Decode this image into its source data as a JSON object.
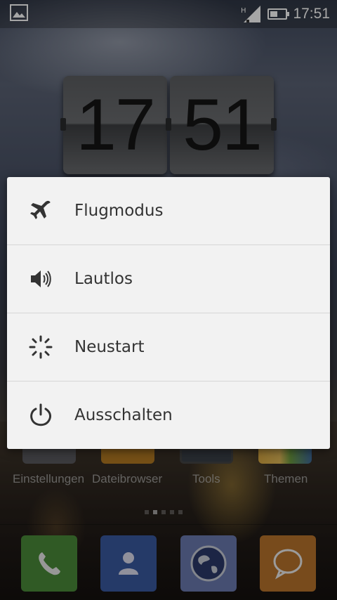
{
  "statusbar": {
    "time": "17:51",
    "network_type": "H",
    "icons": [
      "gallery-notification-icon",
      "signal-icon",
      "battery-icon"
    ]
  },
  "clock_widget": {
    "hours": "17",
    "minutes": "51"
  },
  "power_menu": {
    "items": [
      {
        "label": "Flugmodus",
        "icon": "airplane-icon"
      },
      {
        "label": "Lautlos",
        "icon": "speaker-icon"
      },
      {
        "label": "Neustart",
        "icon": "restart-spinner-icon"
      },
      {
        "label": "Ausschalten",
        "icon": "power-icon"
      }
    ]
  },
  "home_apps": [
    {
      "label": "Einstellungen",
      "icon": "settings-gear-icon"
    },
    {
      "label": "Dateibrowser",
      "icon": "folder-icon"
    },
    {
      "label": "Tools",
      "icon": "tools-icon"
    },
    {
      "label": "Themen",
      "icon": "themes-icon"
    }
  ],
  "page_indicator": {
    "count": 5,
    "active": 1
  },
  "dock": [
    {
      "icon": "phone-icon",
      "color": "#4a8a3a"
    },
    {
      "icon": "contacts-icon",
      "color": "#3a5aa0"
    },
    {
      "icon": "browser-globe-icon",
      "color": "#6a7ab0"
    },
    {
      "icon": "messaging-icon",
      "color": "#b8742c"
    }
  ],
  "colors": {
    "menu_background": "#f2f2f2",
    "menu_text": "#333333",
    "separator": "#d6d6d6"
  }
}
